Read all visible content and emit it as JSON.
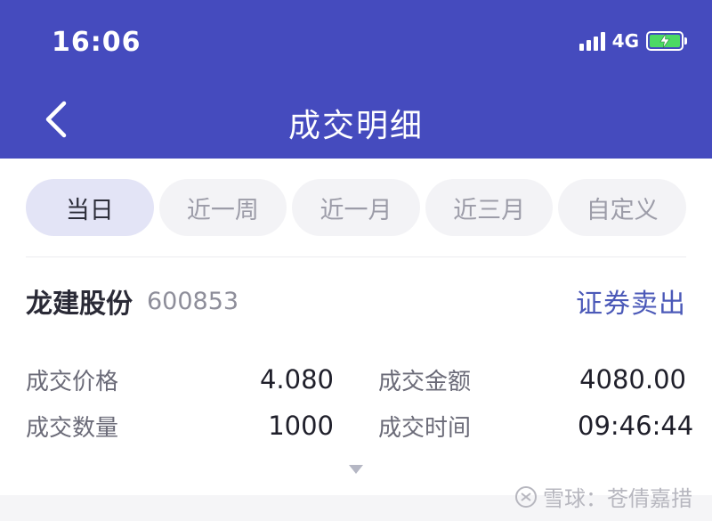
{
  "status_bar": {
    "time": "16:06",
    "network": "4G"
  },
  "header": {
    "title": "成交明细"
  },
  "tabs": [
    {
      "label": "当日",
      "active": true
    },
    {
      "label": "近一周",
      "active": false
    },
    {
      "label": "近一月",
      "active": false
    },
    {
      "label": "近三月",
      "active": false
    },
    {
      "label": "自定义",
      "active": false
    }
  ],
  "trade": {
    "stock_name": "龙建股份",
    "stock_code": "600853",
    "trade_type": "证券卖出",
    "fields": [
      {
        "label": "成交价格",
        "value": "4.080"
      },
      {
        "label": "成交金额",
        "value": "4080.00"
      },
      {
        "label": "成交数量",
        "value": "1000"
      },
      {
        "label": "成交时间",
        "value": "09:46:44"
      }
    ]
  },
  "watermark": {
    "text": "雪球：苍倩嘉措"
  },
  "colors": {
    "header_bg": "#454bbe",
    "accent": "#4b59b8",
    "battery": "#4cd964"
  },
  "icons": {
    "back": "chevron-left-icon",
    "expand": "caret-down-icon",
    "signal": "signal-icon",
    "battery": "battery-charging-icon"
  }
}
